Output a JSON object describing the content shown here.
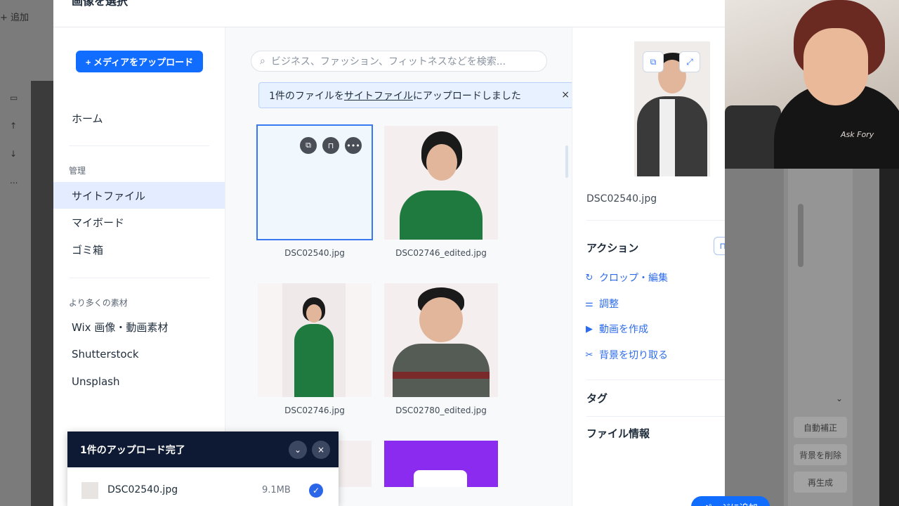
{
  "background": {
    "add_label": "+ 追加",
    "tool_icons": [
      "▭",
      "↑",
      "↓",
      "..."
    ],
    "right_buttons": [
      "自動補正",
      "背景を削除",
      "再生成"
    ]
  },
  "modal": {
    "title": "画像を選択",
    "upload_button": "+ メディアをアップロード",
    "nav": {
      "home": "ホーム",
      "manage_section": "管理",
      "site_files": "サイトファイル",
      "my_board": "マイボード",
      "trash": "ゴミ箱",
      "more_section": "より多くの素材",
      "wix_media": "Wix 画像・動画素材",
      "shutterstock": "Shutterstock",
      "unsplash": "Unsplash"
    },
    "search_placeholder": "ビジネス、ファッション、フィットネスなどを検索...",
    "toast": {
      "prefix": "1件のファイルを",
      "link": "サイトファイル",
      "suffix": "にアップロードしました",
      "close": "×"
    },
    "files": [
      {
        "name": "DSC02540.jpg"
      },
      {
        "name": "DSC02746_edited.jpg"
      },
      {
        "name": "DSC02746.jpg"
      },
      {
        "name": "DSC02780_edited.jpg"
      }
    ],
    "detail": {
      "file_name": "DSC02540.jpg",
      "actions_heading": "アクション",
      "actions": [
        "クロップ・編集",
        "調整",
        "動画を作成",
        "背景を切り取る"
      ],
      "tags_heading": "タグ",
      "file_info_heading": "ファイル情報"
    },
    "add_button": "ページに追加"
  },
  "upload_panel": {
    "title": "1件のアップロード完了",
    "file_name": "DSC02540.jpg",
    "file_size": "9.1MB"
  },
  "colors": {
    "accent": "#116dff",
    "upload_header": "#0e1a33",
    "active_nav": "#e3edff"
  }
}
